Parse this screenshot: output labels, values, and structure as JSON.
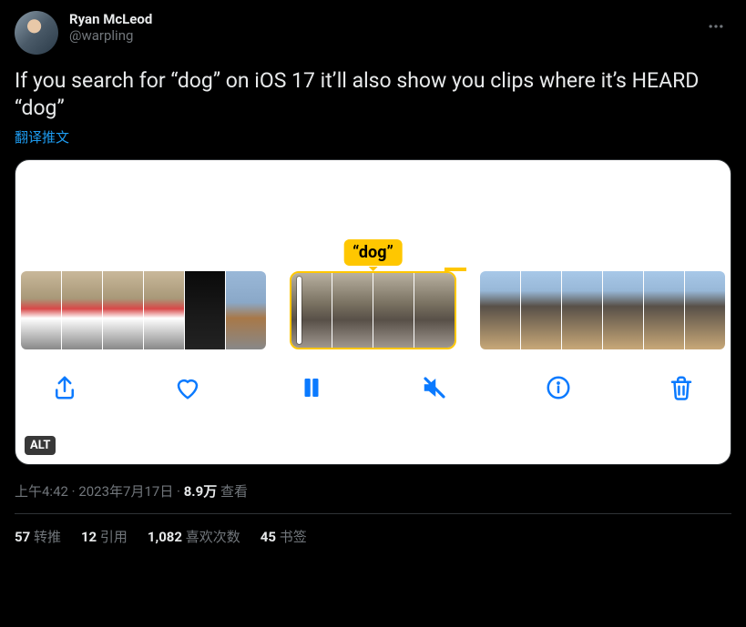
{
  "author": {
    "display_name": "Ryan McLeod",
    "handle": "@warpling"
  },
  "content": {
    "text": "If you search for “dog” on iOS 17 it’ll also show you clips where it’s HEARD “dog”",
    "translate_label": "翻译推文"
  },
  "media": {
    "tag_label": "“dog”",
    "alt_badge": "ALT",
    "icons": {
      "share": "share-icon",
      "heart": "heart-icon",
      "pause": "pause-icon",
      "mute": "mute-icon",
      "info": "info-icon",
      "trash": "trash-icon"
    }
  },
  "meta": {
    "time": "上午4:42",
    "date": "2023年7月17日",
    "dot": " · ",
    "views_count": "8.9万",
    "views_label": " 查看"
  },
  "stats": {
    "retweets": {
      "count": "57",
      "label": " 转推"
    },
    "quotes": {
      "count": "12",
      "label": " 引用"
    },
    "likes": {
      "count": "1,082",
      "label": " 喜欢次数"
    },
    "bookmarks": {
      "count": "45",
      "label": " 书签"
    }
  }
}
